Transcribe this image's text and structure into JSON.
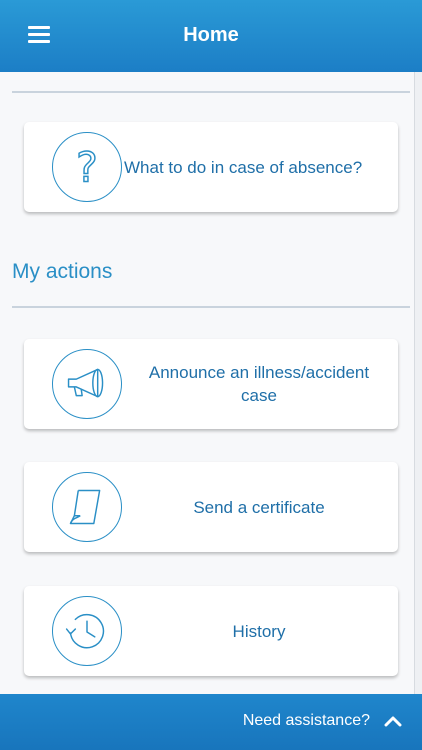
{
  "header": {
    "title": "Home",
    "menu_icon": "hamburger-menu-icon"
  },
  "cards_top": [
    {
      "label": "What to do in case of absence?",
      "icon": "question-icon"
    }
  ],
  "my_actions": {
    "title": "My actions",
    "items": [
      {
        "label": "Announce an illness/accident case",
        "icon": "megaphone-icon"
      },
      {
        "label": "Send a certificate",
        "icon": "document-icon"
      },
      {
        "label": "History",
        "icon": "history-clock-icon"
      }
    ]
  },
  "footer": {
    "label": "Need assistance?",
    "icon": "chevron-up-icon"
  },
  "colors": {
    "header_blue": "#1c7ec6",
    "accent": "#2a8fc6",
    "text_blue": "#1f6fa8"
  }
}
